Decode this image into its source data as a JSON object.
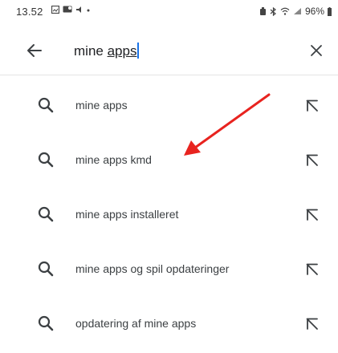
{
  "status_bar": {
    "time": "13.52",
    "battery": "96%"
  },
  "search": {
    "query_prefix": "mine ",
    "query_underlined": "apps",
    "value": "mine apps",
    "back_icon": "arrow-left-icon",
    "clear_icon": "close-icon"
  },
  "suggestions": [
    {
      "label": "mine apps",
      "icon": "search-icon",
      "action_icon": "arrow-up-left-icon"
    },
    {
      "label": "mine apps kmd",
      "icon": "search-icon",
      "action_icon": "arrow-up-left-icon"
    },
    {
      "label": "mine apps installeret",
      "icon": "search-icon",
      "action_icon": "arrow-up-left-icon"
    },
    {
      "label": "mine apps og spil opdateringer",
      "icon": "search-icon",
      "action_icon": "arrow-up-left-icon"
    },
    {
      "label": "opdatering af mine apps",
      "icon": "search-icon",
      "action_icon": "arrow-up-left-icon"
    }
  ],
  "colors": {
    "annotation_arrow": "#e8231f",
    "caret": "#1a73e8",
    "icon": "#3c4043"
  }
}
